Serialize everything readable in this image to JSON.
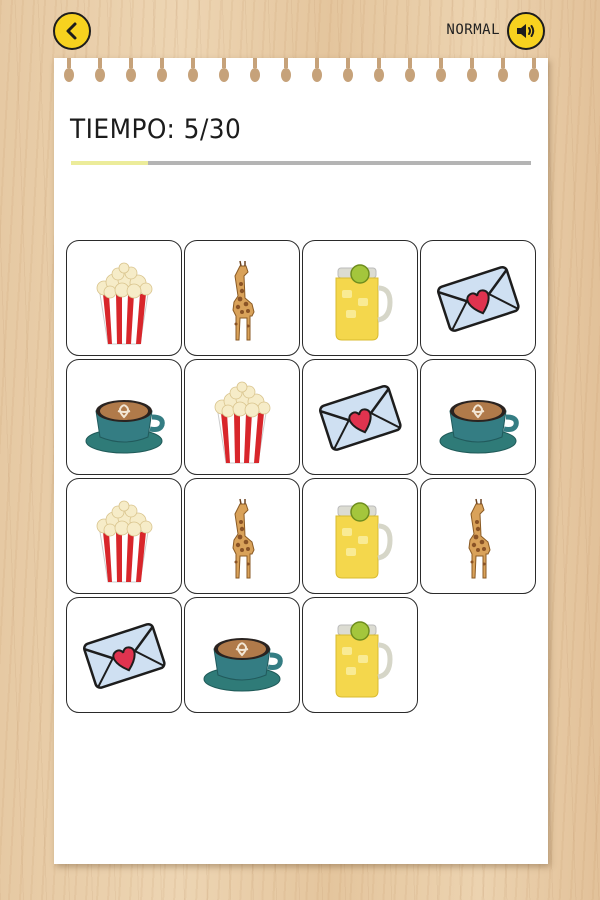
{
  "header": {
    "back_icon": "chevron-left-icon",
    "mode": "NORMAL",
    "sound_icon": "speaker-icon",
    "button_color": "#f7d21f"
  },
  "timer": {
    "label": "TIEMPO:",
    "elapsed": 5,
    "total": 30,
    "text": "5/30",
    "progress_fraction": 0.1667,
    "progress_fill_color": "#ecec9a",
    "progress_track_color": "#b4b4b4"
  },
  "board": {
    "columns": 4,
    "cards": [
      {
        "item": "popcorn"
      },
      {
        "item": "giraffe"
      },
      {
        "item": "lemonade"
      },
      {
        "item": "love-letter"
      },
      {
        "item": "coffee"
      },
      {
        "item": "popcorn"
      },
      {
        "item": "love-letter"
      },
      {
        "item": "coffee"
      },
      {
        "item": "popcorn"
      },
      {
        "item": "giraffe"
      },
      {
        "item": "lemonade"
      },
      {
        "item": "giraffe"
      },
      {
        "item": "love-letter"
      },
      {
        "item": "coffee"
      },
      {
        "item": "lemonade"
      }
    ]
  }
}
